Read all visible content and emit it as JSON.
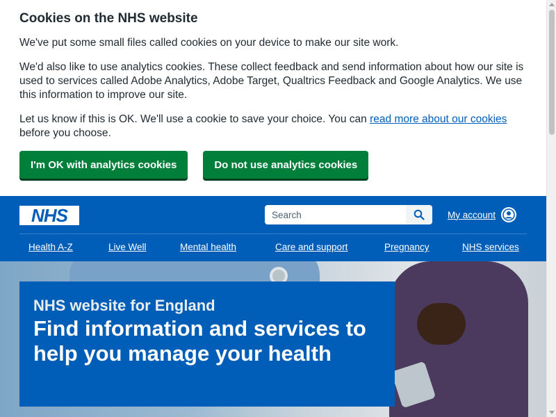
{
  "cookie_banner": {
    "heading": "Cookies on the NHS website",
    "p1": "We've put some small files called cookies on your device to make our site work.",
    "p2": "We'd also like to use analytics cookies. These collect feedback and send information about how our site is used to services called Adobe Analytics, Adobe Target, Qualtrics Feedback and Google Analytics. We use this information to improve our site.",
    "p3_before": "Let us know if this is OK. We'll use a cookie to save your choice. You can ",
    "p3_link": "read more about our cookies",
    "p3_after": " before you choose.",
    "accept_label": "I'm OK with analytics cookies",
    "reject_label": "Do not use analytics cookies"
  },
  "header": {
    "logo_text": "NHS",
    "search_placeholder": "Search",
    "account_label": "My account"
  },
  "nav": {
    "items": [
      "Health A-Z",
      "Live Well",
      "Mental health",
      "Care and support",
      "Pregnancy",
      "NHS services"
    ]
  },
  "hero": {
    "subtitle": "NHS website for England",
    "title": "Find information and services to help you manage your health"
  },
  "colors": {
    "nhs_blue": "#005eb8",
    "button_green": "#007f3b",
    "text": "#212b32"
  }
}
